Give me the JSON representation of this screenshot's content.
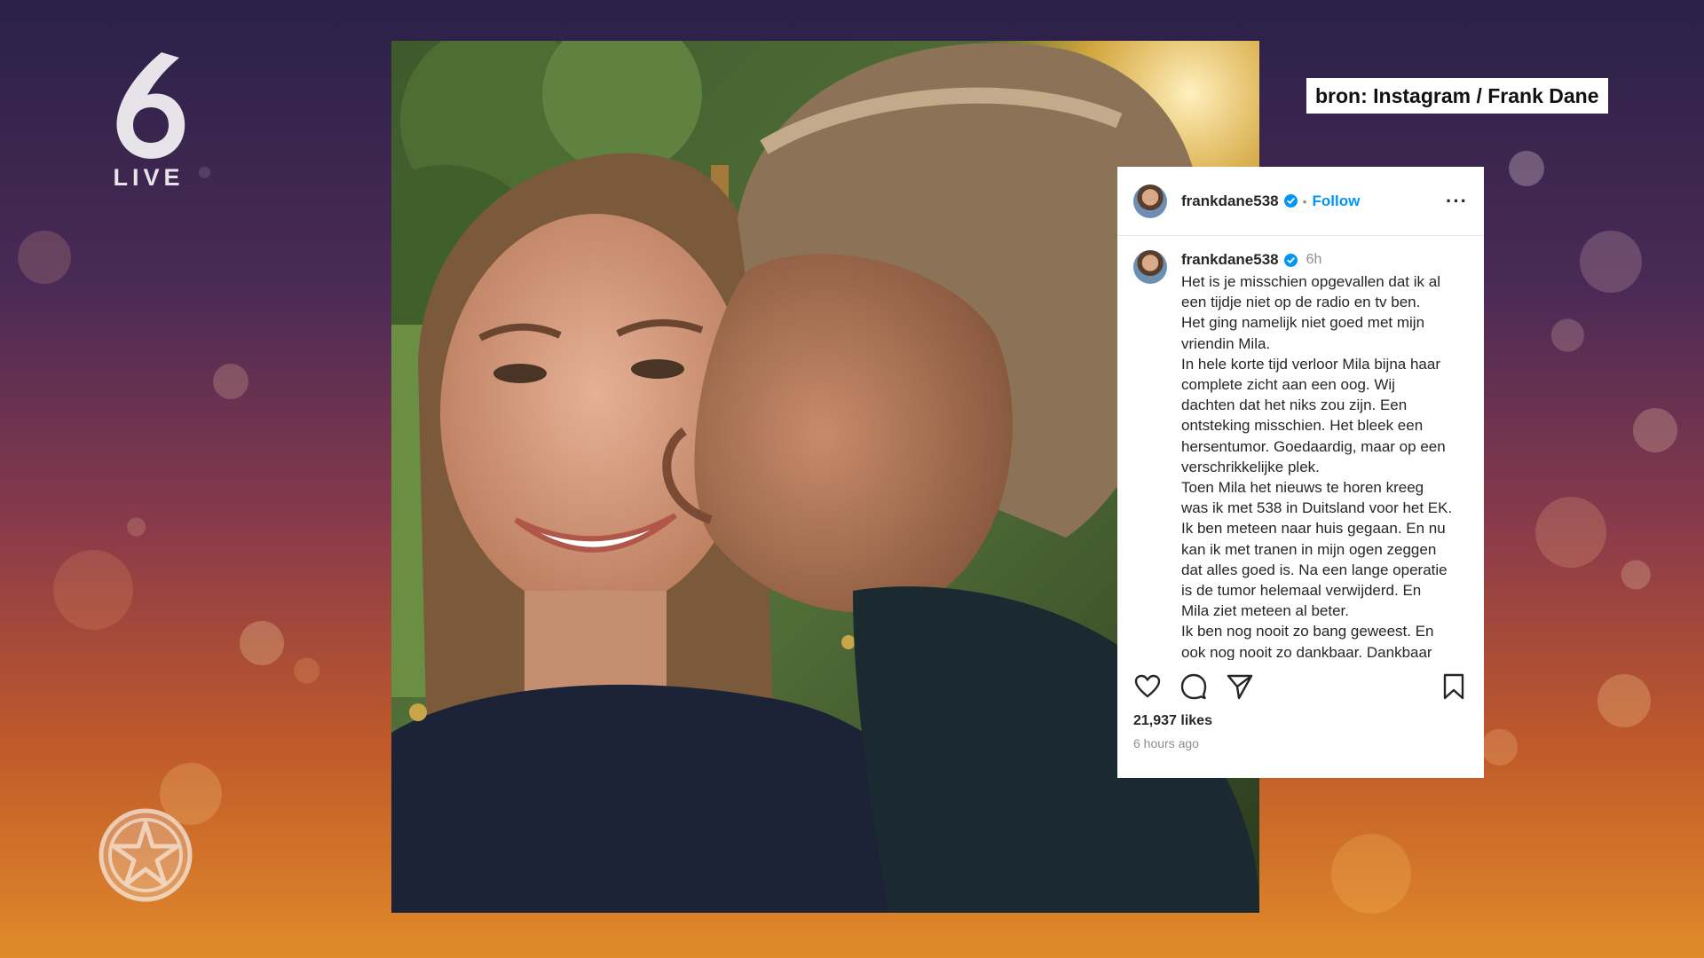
{
  "broadcast": {
    "channel_number": "6",
    "channel_suffix": "LIVE",
    "source_label": "bron: Instagram / Frank Dane"
  },
  "post": {
    "header": {
      "username": "frankdane538",
      "separator": "•",
      "follow_label": "Follow",
      "more_label": "···"
    },
    "caption": {
      "username": "frankdane538",
      "time_ago": "6h",
      "lines": [
        "Het is je misschien opgevallen dat ik al",
        "een tijdje niet op de radio en tv ben.",
        "Het ging namelijk niet goed met mijn",
        "vriendin Mila.",
        "In hele korte tijd verloor Mila bijna haar",
        "complete zicht aan een oog. Wij",
        "dachten dat het niks zou zijn. Een",
        "ontsteking misschien. Het bleek een",
        "hersentumor. Goedaardig, maar op een",
        "verschrikkelijke plek.",
        "Toen Mila het nieuws te horen kreeg",
        "was ik met 538 in Duitsland voor het EK.",
        "Ik ben meteen naar huis gegaan. En nu",
        "kan ik met tranen in mijn ogen zeggen",
        "dat alles goed is. Na een lange operatie",
        "is de tumor helemaal verwijderd. En",
        "Mila ziet meteen al beter.",
        "Ik ben nog nooit zo bang geweest. En",
        "ook nog nooit zo dankbaar. Dankbaar"
      ]
    },
    "likes": "21,937 likes",
    "posted_ago": "6 hours ago"
  },
  "icons": {
    "channel_logo": "six-logo-icon",
    "star_badge": "star-badge-icon",
    "verified": "verified-badge-icon",
    "like": "heart-icon",
    "comment": "comment-icon",
    "share": "send-icon",
    "save": "bookmark-icon"
  },
  "colors": {
    "follow_link": "#0095f6",
    "verified_badge": "#0095f6",
    "muted_text": "#8e8e8e"
  }
}
